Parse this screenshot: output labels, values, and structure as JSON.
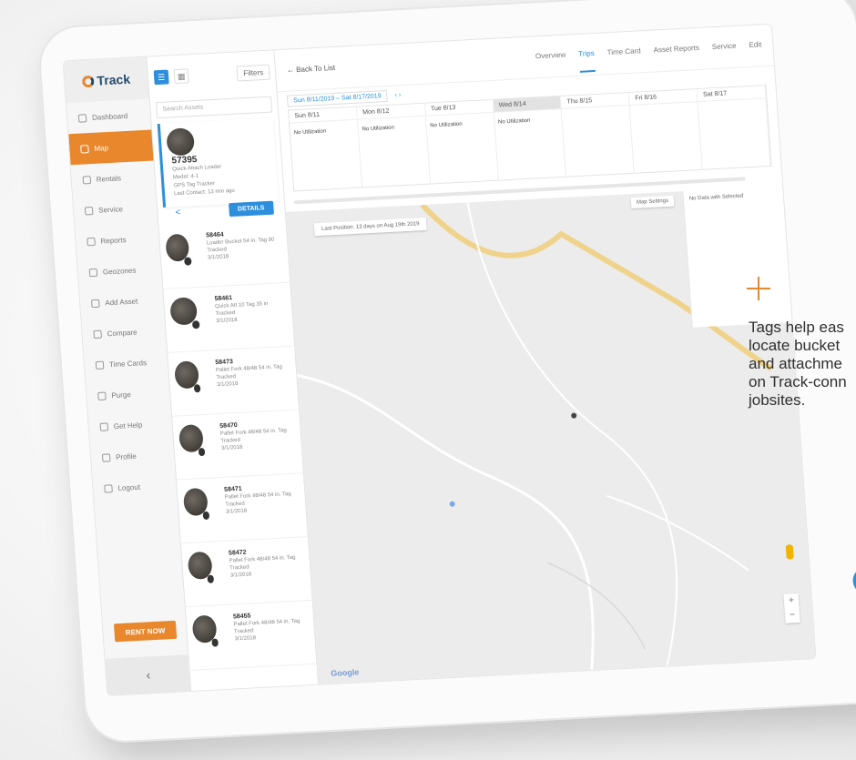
{
  "app": {
    "logo_text": "Track"
  },
  "sidebar": {
    "items": [
      {
        "label": "Dashboard",
        "icon": "dashboard-icon"
      },
      {
        "label": "Map",
        "icon": "map-icon",
        "active": true
      },
      {
        "label": "Rentals",
        "icon": "rentals-icon"
      },
      {
        "label": "Service",
        "icon": "service-icon"
      },
      {
        "label": "Reports",
        "icon": "reports-icon"
      },
      {
        "label": "Geozones",
        "icon": "geozones-icon"
      },
      {
        "label": "Add Asset",
        "icon": "add-asset-icon"
      },
      {
        "label": "Compare",
        "icon": "compare-icon"
      },
      {
        "label": "Time Cards",
        "icon": "timecards-icon"
      },
      {
        "label": "Purge",
        "icon": "purge-icon"
      },
      {
        "label": "Get Help",
        "icon": "help-icon"
      },
      {
        "label": "Profile",
        "icon": "profile-icon"
      },
      {
        "label": "Logout",
        "icon": "logout-icon"
      }
    ],
    "rent_now": "RENT NOW",
    "collapse": "‹"
  },
  "list": {
    "filters": "Filters",
    "search_placeholder": "Search Assets",
    "selected": {
      "title": "57395",
      "line1": "Quick Attach Loader",
      "line2": "Model: 4-1",
      "line3": "GPS Tag Tracker",
      "line4": "Last Contact: 13 min ago",
      "details": "DETAILS"
    },
    "items": [
      {
        "id": "58464",
        "desc": "Loader Bucket 54 in. Tag 90 Tracked",
        "sub": "3/1/2018"
      },
      {
        "id": "58461",
        "desc": "Quick Att 10 Tag 35 in Tracked",
        "sub": "3/1/2018"
      },
      {
        "id": "58473",
        "desc": "Pallet Fork 48/48 54 in. Tag Tracked",
        "sub": "3/1/2018"
      },
      {
        "id": "58470",
        "desc": "Pallet Fork 48/48 54 in. Tag Tracked",
        "sub": "3/1/2018"
      },
      {
        "id": "58471",
        "desc": "Pallet Fork 48/48 54 in. Tag Tracked",
        "sub": "3/1/2018"
      },
      {
        "id": "58472",
        "desc": "Pallet Fork 48/48 54 in. Tag Tracked",
        "sub": "3/1/2018"
      },
      {
        "id": "58455",
        "desc": "Pallet Fork 48/48 54 in. Tag Tracked",
        "sub": "3/1/2018"
      }
    ]
  },
  "topbar": {
    "back": "← Back To List",
    "tabs": [
      "Overview",
      "Trips",
      "Time Card",
      "Asset Reports",
      "Service",
      "Edit"
    ],
    "selected_tab": "Trips"
  },
  "trips": {
    "range": "Sun 8/11/2019 – Sat 8/17/2019",
    "days": [
      {
        "label": "Sun 8/11",
        "event": "No Utilization"
      },
      {
        "label": "Mon 8/12",
        "event": "No Utilization"
      },
      {
        "label": "Tue 8/13",
        "event": "No Utilization"
      },
      {
        "label": "Wed 8/14",
        "event": "No Utilization",
        "today": true
      },
      {
        "label": "Thu 8/15",
        "event": ""
      },
      {
        "label": "Fri 8/16",
        "event": ""
      },
      {
        "label": "Sat 8/17",
        "event": ""
      }
    ]
  },
  "map": {
    "last_position": "Last Position: 13 days on Aug 19th 2019",
    "layers": "Map Settings",
    "side_text": "No Data with Selected",
    "google": "Google",
    "zoom_in": "+",
    "zoom_out": "−"
  },
  "caption": {
    "text": "Tags help eas\nlocate bucket\nand attachme\non Track-conn\njobsites."
  },
  "colors": {
    "accent": "#e8872c",
    "primary": "#2d8fdb"
  }
}
